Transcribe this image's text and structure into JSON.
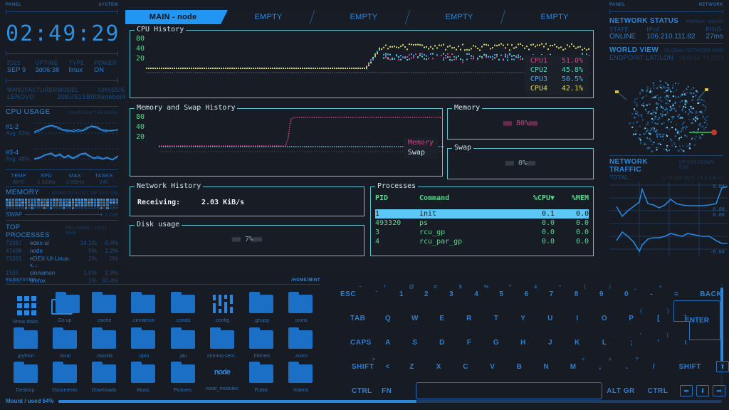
{
  "left": {
    "tag_left": "PANEL",
    "tag_right": "SYSTEM",
    "clock": "02:49:29",
    "sysinfo": [
      {
        "key": "2021",
        "value": "SEP 9"
      },
      {
        "key": "UPTIME",
        "value": "3d06:38"
      },
      {
        "key": "TYPE",
        "value": "linux"
      },
      {
        "key": "POWER",
        "value": "ON"
      }
    ],
    "hardware": [
      {
        "key": "MANUFACTURER",
        "value": "LENOVO"
      },
      {
        "key": "MODEL",
        "value": "20BUS1SB00"
      },
      {
        "key": "CHASSIS",
        "value": "Notebook"
      }
    ],
    "cpu": {
      "title": "CPU USAGE",
      "subtitle": "Intel®Core™ i5-5300U",
      "cores": [
        {
          "label": "#1-2",
          "avg": "Avg. 53%"
        },
        {
          "label": "#3-4",
          "avg": "Avg. 48%"
        }
      ],
      "stats": [
        {
          "key": "TEMP",
          "value": "88°C"
        },
        {
          "key": "SPD",
          "value": "2.3GHz"
        },
        {
          "key": "MAX",
          "value": "2.9GHz"
        },
        {
          "key": "TASKS",
          "value": "240"
        }
      ]
    },
    "memory": {
      "title": "MEMORY",
      "subtitle": "USING 12.4 OUT OF 15.5 GiB",
      "swap_label": "SWAP",
      "swap_value": "0 GiB"
    },
    "processes": {
      "title": "TOP PROCESSES",
      "subtitle": "PID | NAME | CPU | MEM",
      "rows": [
        {
          "pid": "73387",
          "name": "edex-ui",
          "cpu": "34.1%",
          "mem": "6.4%"
        },
        {
          "pid": "47498",
          "name": "node",
          "cpu": "5%",
          "mem": "2.2%"
        },
        {
          "pid": "73391",
          "name": "eDEX-UI-Linux-x...",
          "cpu": "2%",
          "mem": "0%"
        },
        {
          "pid": "1935",
          "name": "cinnamon",
          "cpu": "1.5%",
          "mem": "2.9%"
        },
        {
          "pid": "19202",
          "name": "firefox",
          "cpu": "1%",
          "mem": "33.4%"
        }
      ]
    }
  },
  "terminal": {
    "tabs": [
      {
        "label": "MAIN - node",
        "active": true
      },
      {
        "label": "EMPTY",
        "active": false
      },
      {
        "label": "EMPTY",
        "active": false
      },
      {
        "label": "EMPTY",
        "active": false
      },
      {
        "label": "EMPTY",
        "active": false
      }
    ],
    "cpu_history": {
      "caption": "CPU History",
      "yticks": [
        "80",
        "40",
        "20"
      ],
      "legend": [
        {
          "name": "CPU1",
          "value": "51.0%",
          "color": "#d93f87"
        },
        {
          "name": "CPU2",
          "value": "45.8%",
          "color": "#4fd6c0"
        },
        {
          "name": "CPU3",
          "value": "50.5%",
          "color": "#3da8f5"
        },
        {
          "name": "CPU4",
          "value": "42.1%",
          "color": "#d8d86a"
        }
      ]
    },
    "mem_history": {
      "caption": "Memory and Swap History",
      "yticks": [
        "80",
        "40",
        "20"
      ],
      "legend": [
        {
          "name": "Memory",
          "color": "#d93f87"
        },
        {
          "name": "Swap",
          "color": "#cfe6f2"
        }
      ]
    },
    "memory_box": {
      "caption": "Memory",
      "value": "80%"
    },
    "swap_box": {
      "caption": "Swap",
      "value": "0%"
    },
    "network_history": {
      "caption": "Network History",
      "label": "Receiving:",
      "value": "2.03 KiB/s"
    },
    "disk_usage": {
      "caption": "Disk usage",
      "value": "7%"
    },
    "processes": {
      "caption": "Processes",
      "headers": [
        "PID",
        "Command",
        "%CPU▼",
        "%MEM"
      ],
      "rows": [
        {
          "pid": "1",
          "command": "init",
          "cpu": "0.1",
          "mem": "0.0",
          "selected": true
        },
        {
          "pid": "493320",
          "command": "ps",
          "cpu": "0.0",
          "mem": "0.0",
          "selected": false
        },
        {
          "pid": "3",
          "command": "rcu_gp",
          "cpu": "0.0",
          "mem": "0.0",
          "selected": false
        },
        {
          "pid": "4",
          "command": "rcu_par_gp",
          "cpu": "0.0",
          "mem": "0.0",
          "selected": false
        }
      ]
    }
  },
  "right": {
    "tag_left": "PANEL",
    "tag_right": "NETWORK",
    "network_status": {
      "title": "NETWORK STATUS",
      "subtitle": "Interface: wlp3s0",
      "fields": [
        {
          "key": "STATE",
          "value": "ONLINE"
        },
        {
          "key": "IPv4",
          "value": "106.210.111.82"
        },
        {
          "key": "PING",
          "value": "27ms"
        }
      ]
    },
    "world_view": {
      "title": "WORLD VIEW",
      "subtitle": "GLOBAL NETWORK MAP",
      "latlon_label": "ENDPOINT LAT/LON",
      "latlon_value": "28.6542, 77.2373"
    },
    "network_traffic": {
      "title": "NETWORK TRAFFIC",
      "subtitle": "UP 0.04 DOWN 0.02",
      "total_label": "TOTAL",
      "total_value": "1.79 GB OUT, 13.8 GB IN",
      "axis": [
        "0.04",
        "0.00",
        "0.00",
        "-0.04"
      ]
    }
  },
  "filesystem": {
    "tag": "FILESYSTEM",
    "path": "/home/mint",
    "items": [
      {
        "name": "Show disks",
        "icon": "grid-icon"
      },
      {
        "name": "Go up",
        "icon": "folder-up-icon"
      },
      {
        "name": ".cache",
        "icon": "folder-icon"
      },
      {
        "name": ".cinnamon",
        "icon": "folder-icon"
      },
      {
        "name": ".conda",
        "icon": "folder-icon"
      },
      {
        "name": ".config",
        "icon": "sliders-icon"
      },
      {
        "name": ".gnupg",
        "icon": "folder-icon"
      },
      {
        "name": ".icons",
        "icon": "folder-icon"
      },
      {
        "name": ".ipython",
        "icon": "folder-icon"
      },
      {
        "name": ".local",
        "icon": "folder-icon"
      },
      {
        "name": ".mozilla",
        "icon": "folder-icon"
      },
      {
        "name": ".npm",
        "icon": "folder-icon"
      },
      {
        "name": ".pki",
        "icon": "folder-icon"
      },
      {
        "name": ".stremio-serv...",
        "icon": "folder-icon"
      },
      {
        "name": ".themes",
        "icon": "folder-icon"
      },
      {
        "name": ".zoom",
        "icon": "folder-icon"
      },
      {
        "name": "Desktop",
        "icon": "folder-icon"
      },
      {
        "name": "Documents",
        "icon": "folder-icon"
      },
      {
        "name": "Downloads",
        "icon": "folder-icon"
      },
      {
        "name": "Music",
        "icon": "folder-icon"
      },
      {
        "name": "Pictures",
        "icon": "folder-icon"
      },
      {
        "name": "node_modules",
        "icon": "node-icon"
      },
      {
        "name": "Public",
        "icon": "folder-icon"
      },
      {
        "name": "Videos",
        "icon": "folder-icon"
      }
    ],
    "mount_label": "Mount / used 54%",
    "mount_percent": 54
  },
  "keyboard": {
    "row1": [
      {
        "main": "ESC",
        "alt": "",
        "cls": "k-esc"
      },
      {
        "main": "`",
        "alt": "~",
        "cls": "k-w"
      },
      {
        "main": "1",
        "alt": "!",
        "cls": "k-w"
      },
      {
        "main": "2",
        "alt": "@",
        "cls": "k-w"
      },
      {
        "main": "3",
        "alt": "#",
        "cls": "k-w"
      },
      {
        "main": "4",
        "alt": "$",
        "cls": "k-w"
      },
      {
        "main": "5",
        "alt": "%",
        "cls": "k-w"
      },
      {
        "main": "6",
        "alt": "^",
        "cls": "k-w"
      },
      {
        "main": "7",
        "alt": "&",
        "cls": "k-w"
      },
      {
        "main": "8",
        "alt": "*",
        "cls": "k-w"
      },
      {
        "main": "9",
        "alt": "(",
        "cls": "k-w"
      },
      {
        "main": "0",
        "alt": ")",
        "cls": "k-w"
      },
      {
        "main": "-",
        "alt": "_",
        "cls": "k-w"
      },
      {
        "main": "=",
        "alt": "+",
        "cls": "k-w"
      },
      {
        "main": "BACK",
        "alt": "",
        "cls": "k-back"
      }
    ],
    "row2": [
      {
        "main": "TAB",
        "alt": "",
        "cls": "k-tab"
      },
      {
        "main": "Q",
        "alt": "",
        "cls": "k-w"
      },
      {
        "main": "W",
        "alt": "",
        "cls": "k-w"
      },
      {
        "main": "E",
        "alt": "",
        "cls": "k-w"
      },
      {
        "main": "R",
        "alt": "",
        "cls": "k-w"
      },
      {
        "main": "T",
        "alt": "",
        "cls": "k-w"
      },
      {
        "main": "Y",
        "alt": "",
        "cls": "k-w"
      },
      {
        "main": "U",
        "alt": "",
        "cls": "k-w"
      },
      {
        "main": "I",
        "alt": "",
        "cls": "k-w"
      },
      {
        "main": "O",
        "alt": "",
        "cls": "k-w"
      },
      {
        "main": "P",
        "alt": "",
        "cls": "k-w"
      },
      {
        "main": "[",
        "alt": "{",
        "cls": "k-w"
      },
      {
        "main": "]",
        "alt": "}",
        "cls": "k-w"
      }
    ],
    "row3": [
      {
        "main": "CAPS",
        "alt": "",
        "cls": "k-caps"
      },
      {
        "main": "A",
        "alt": "",
        "cls": "k-w"
      },
      {
        "main": "S",
        "alt": "",
        "cls": "k-w"
      },
      {
        "main": "D",
        "alt": "",
        "cls": "k-w"
      },
      {
        "main": "F",
        "alt": "",
        "cls": "k-w"
      },
      {
        "main": "G",
        "alt": "",
        "cls": "k-w"
      },
      {
        "main": "H",
        "alt": "",
        "cls": "k-w"
      },
      {
        "main": "J",
        "alt": "",
        "cls": "k-w"
      },
      {
        "main": "K",
        "alt": "",
        "cls": "k-w"
      },
      {
        "main": "L",
        "alt": "",
        "cls": "k-w"
      },
      {
        "main": ";",
        "alt": ":",
        "cls": "k-w"
      },
      {
        "main": "'",
        "alt": "\"",
        "cls": "k-w"
      },
      {
        "main": "\\",
        "alt": "|",
        "cls": "k-w"
      }
    ],
    "row4": [
      {
        "main": "SHIFT",
        "alt": "",
        "cls": "k-shift"
      },
      {
        "main": "<",
        "alt": ">",
        "cls": "k-sm"
      },
      {
        "main": "Z",
        "alt": "",
        "cls": "k-w"
      },
      {
        "main": "X",
        "alt": "",
        "cls": "k-w"
      },
      {
        "main": "C",
        "alt": "",
        "cls": "k-w"
      },
      {
        "main": "V",
        "alt": "",
        "cls": "k-w"
      },
      {
        "main": "B",
        "alt": "",
        "cls": "k-w"
      },
      {
        "main": "N",
        "alt": "",
        "cls": "k-w"
      },
      {
        "main": "M",
        "alt": "",
        "cls": "k-w"
      },
      {
        "main": ",",
        "alt": "<",
        "cls": "k-w"
      },
      {
        "main": ".",
        "alt": ">",
        "cls": "k-w"
      },
      {
        "main": "/",
        "alt": "?",
        "cls": "k-w"
      },
      {
        "main": "SHIFT",
        "alt": "",
        "cls": "k-shift2"
      }
    ],
    "row5": [
      {
        "main": "CTRL",
        "alt": "",
        "cls": "k-ctrl"
      },
      {
        "main": "FN",
        "alt": "",
        "cls": "k-fn"
      }
    ],
    "row5_right": [
      {
        "main": "ALT GR",
        "alt": "",
        "cls": "k-altgr"
      },
      {
        "main": "CTRL",
        "alt": "",
        "cls": "k-altgr"
      }
    ],
    "enter": "ENTER",
    "arrow_up": "⬆",
    "arrow_left": "⬅",
    "arrow_down": "⬇",
    "arrow_right": "➡"
  },
  "chart_data": [
    {
      "type": "line",
      "title": "CPU History",
      "ylabel": "",
      "ylim": [
        0,
        100
      ],
      "yticks": [
        20,
        40,
        80
      ],
      "series": [
        {
          "name": "CPU1",
          "color": "#d93f87",
          "final": 51.0
        },
        {
          "name": "CPU2",
          "color": "#4fd6c0",
          "final": 45.8
        },
        {
          "name": "CPU3",
          "color": "#3da8f5",
          "final": 50.5
        },
        {
          "name": "CPU4",
          "color": "#d8d86a",
          "final": 42.1
        }
      ]
    },
    {
      "type": "line",
      "title": "Memory and Swap History",
      "ylim": [
        0,
        100
      ],
      "yticks": [
        20,
        40,
        80
      ],
      "series": [
        {
          "name": "Memory",
          "color": "#d93f87",
          "final": 80
        },
        {
          "name": "Swap",
          "color": "#cfe6f2",
          "final": 0
        }
      ]
    },
    {
      "type": "line",
      "title": "NETWORK TRAFFIC",
      "ylim": [
        -0.04,
        0.04
      ],
      "yticks": [
        -0.04,
        0.0,
        0.04
      ],
      "series": [
        {
          "name": "UP",
          "color": "#2b86dd",
          "final": 0.04
        },
        {
          "name": "DOWN",
          "color": "#2b86dd",
          "final": 0.02
        }
      ]
    }
  ]
}
